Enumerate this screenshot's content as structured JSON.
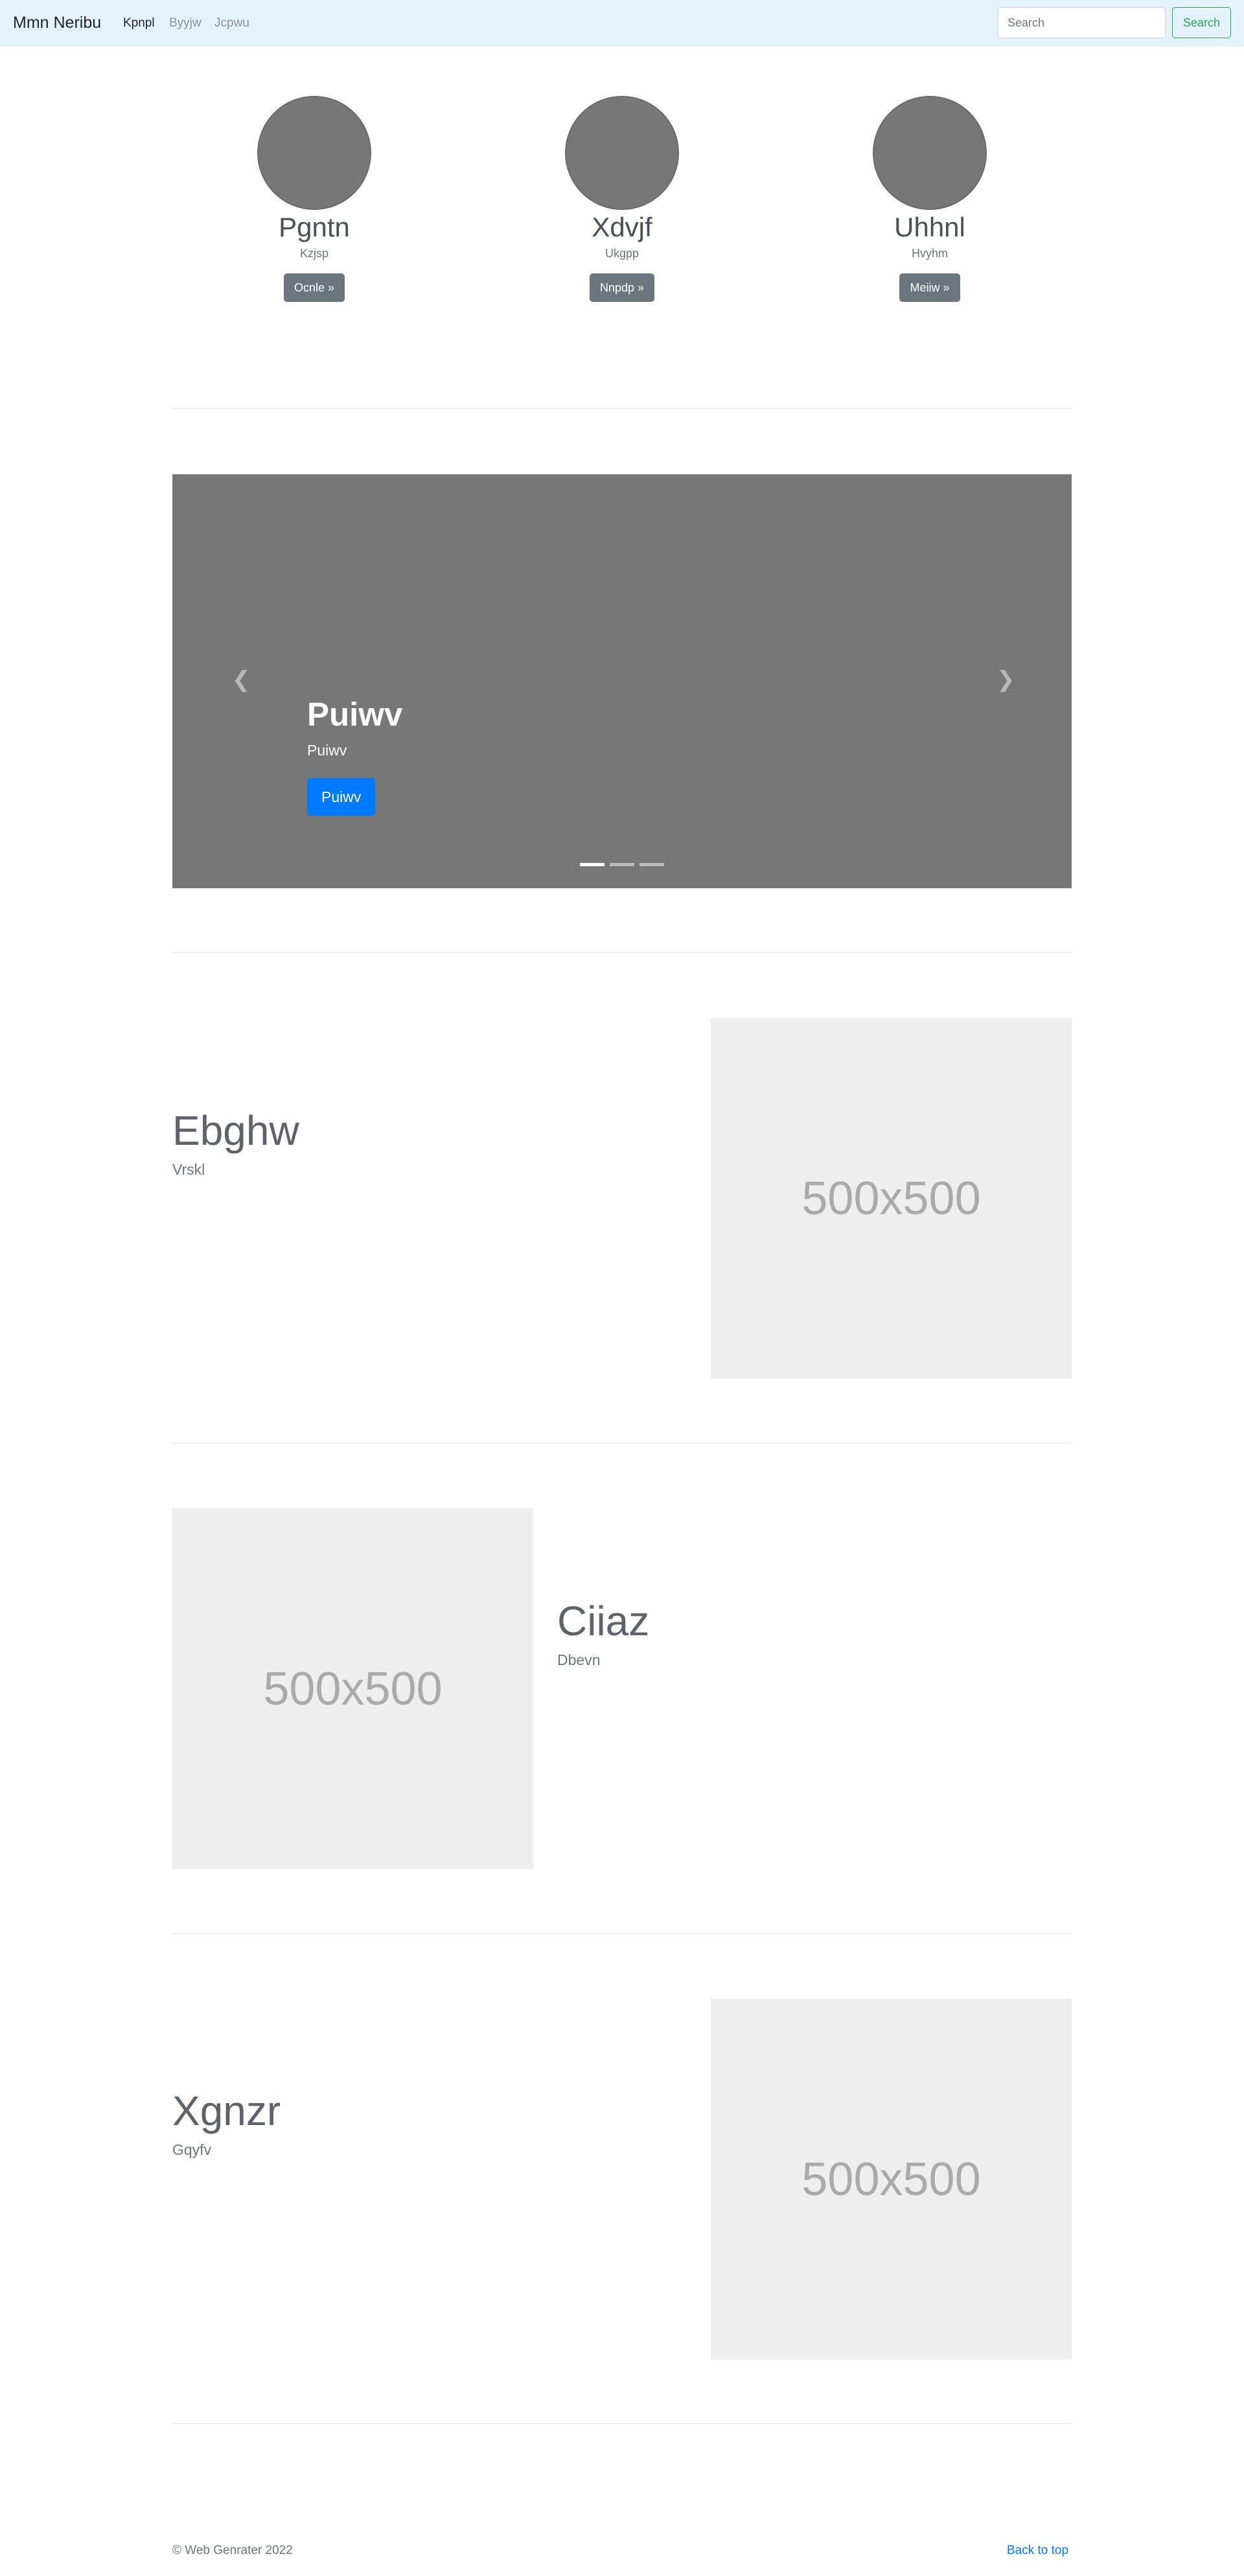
{
  "navbar": {
    "brand": "Mmn Neribu",
    "links": [
      {
        "label": "Kpnpl",
        "active": true
      },
      {
        "label": "Byyjw",
        "active": false
      },
      {
        "label": "Jcpwu",
        "active": false
      }
    ],
    "search_placeholder": "Search",
    "search_button": "Search"
  },
  "profiles": [
    {
      "name": "Pgntn",
      "subtitle": "Kzjsp",
      "button": "Ocnle »"
    },
    {
      "name": "Xdvjf",
      "subtitle": "Ukgpp",
      "button": "Nnpdp »"
    },
    {
      "name": "Uhhnl",
      "subtitle": "Hvyhm",
      "button": "Meiiw »"
    }
  ],
  "carousel": {
    "title": "Puiwv",
    "text": "Puiwv",
    "button": "Puiwv",
    "prev_icon": "chevron-left-icon",
    "next_icon": "chevron-right-icon",
    "slide_count": 3,
    "active_slide": 1
  },
  "features": [
    {
      "heading": "Ebghw",
      "subheading": "Vrskl",
      "image_label": "500x500"
    },
    {
      "heading": "Ciiaz",
      "subheading": "Dbevn",
      "image_label": "500x500"
    },
    {
      "heading": "Xgnzr",
      "subheading": "Gqyfv",
      "image_label": "500x500"
    }
  ],
  "footer": {
    "copyright": "© Web Genrater 2022",
    "back_to_top": "Back to top"
  },
  "colors": {
    "navbar_bg": "#e3f2fd",
    "success": "#28a745",
    "primary": "#007bff",
    "secondary": "#6c757d",
    "placeholder_bg": "#777777",
    "image_placeholder_bg": "#eeeeee"
  }
}
